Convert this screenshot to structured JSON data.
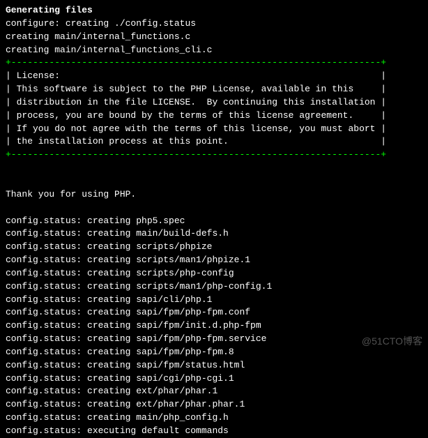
{
  "header": {
    "generating": "Generating files",
    "configure": "configure: creating ./config.status",
    "creating1": "creating main/internal_functions.c",
    "creating2": "creating main/internal_functions_cli.c"
  },
  "separator_top": "+--------------------------------------------------------------------+",
  "license": {
    "line1": "| License:                                                           |",
    "line2": "| This software is subject to the PHP License, available in this     |",
    "line3": "| distribution in the file LICENSE.  By continuing this installation |",
    "line4": "| process, you are bound by the terms of this license agreement.     |",
    "line5": "| If you do not agree with the terms of this license, you must abort |",
    "line6": "| the installation process at this point.                            |"
  },
  "separator_bottom": "+--------------------------------------------------------------------+",
  "thanks": "Thank you for using PHP.",
  "status": {
    "line1": "config.status: creating php5.spec",
    "line2": "config.status: creating main/build-defs.h",
    "line3": "config.status: creating scripts/phpize",
    "line4": "config.status: creating scripts/man1/phpize.1",
    "line5": "config.status: creating scripts/php-config",
    "line6": "config.status: creating scripts/man1/php-config.1",
    "line7": "config.status: creating sapi/cli/php.1",
    "line8": "config.status: creating sapi/fpm/php-fpm.conf",
    "line9": "config.status: creating sapi/fpm/init.d.php-fpm",
    "line10": "config.status: creating sapi/fpm/php-fpm.service",
    "line11": "config.status: creating sapi/fpm/php-fpm.8",
    "line12": "config.status: creating sapi/fpm/status.html",
    "line13": "config.status: creating sapi/cgi/php-cgi.1",
    "line14": "config.status: creating ext/phar/phar.1",
    "line15": "config.status: creating ext/phar/phar.phar.1",
    "line16": "config.status: creating main/php_config.h",
    "line17": "config.status: executing default commands"
  },
  "watermark": "@51CTO博客"
}
